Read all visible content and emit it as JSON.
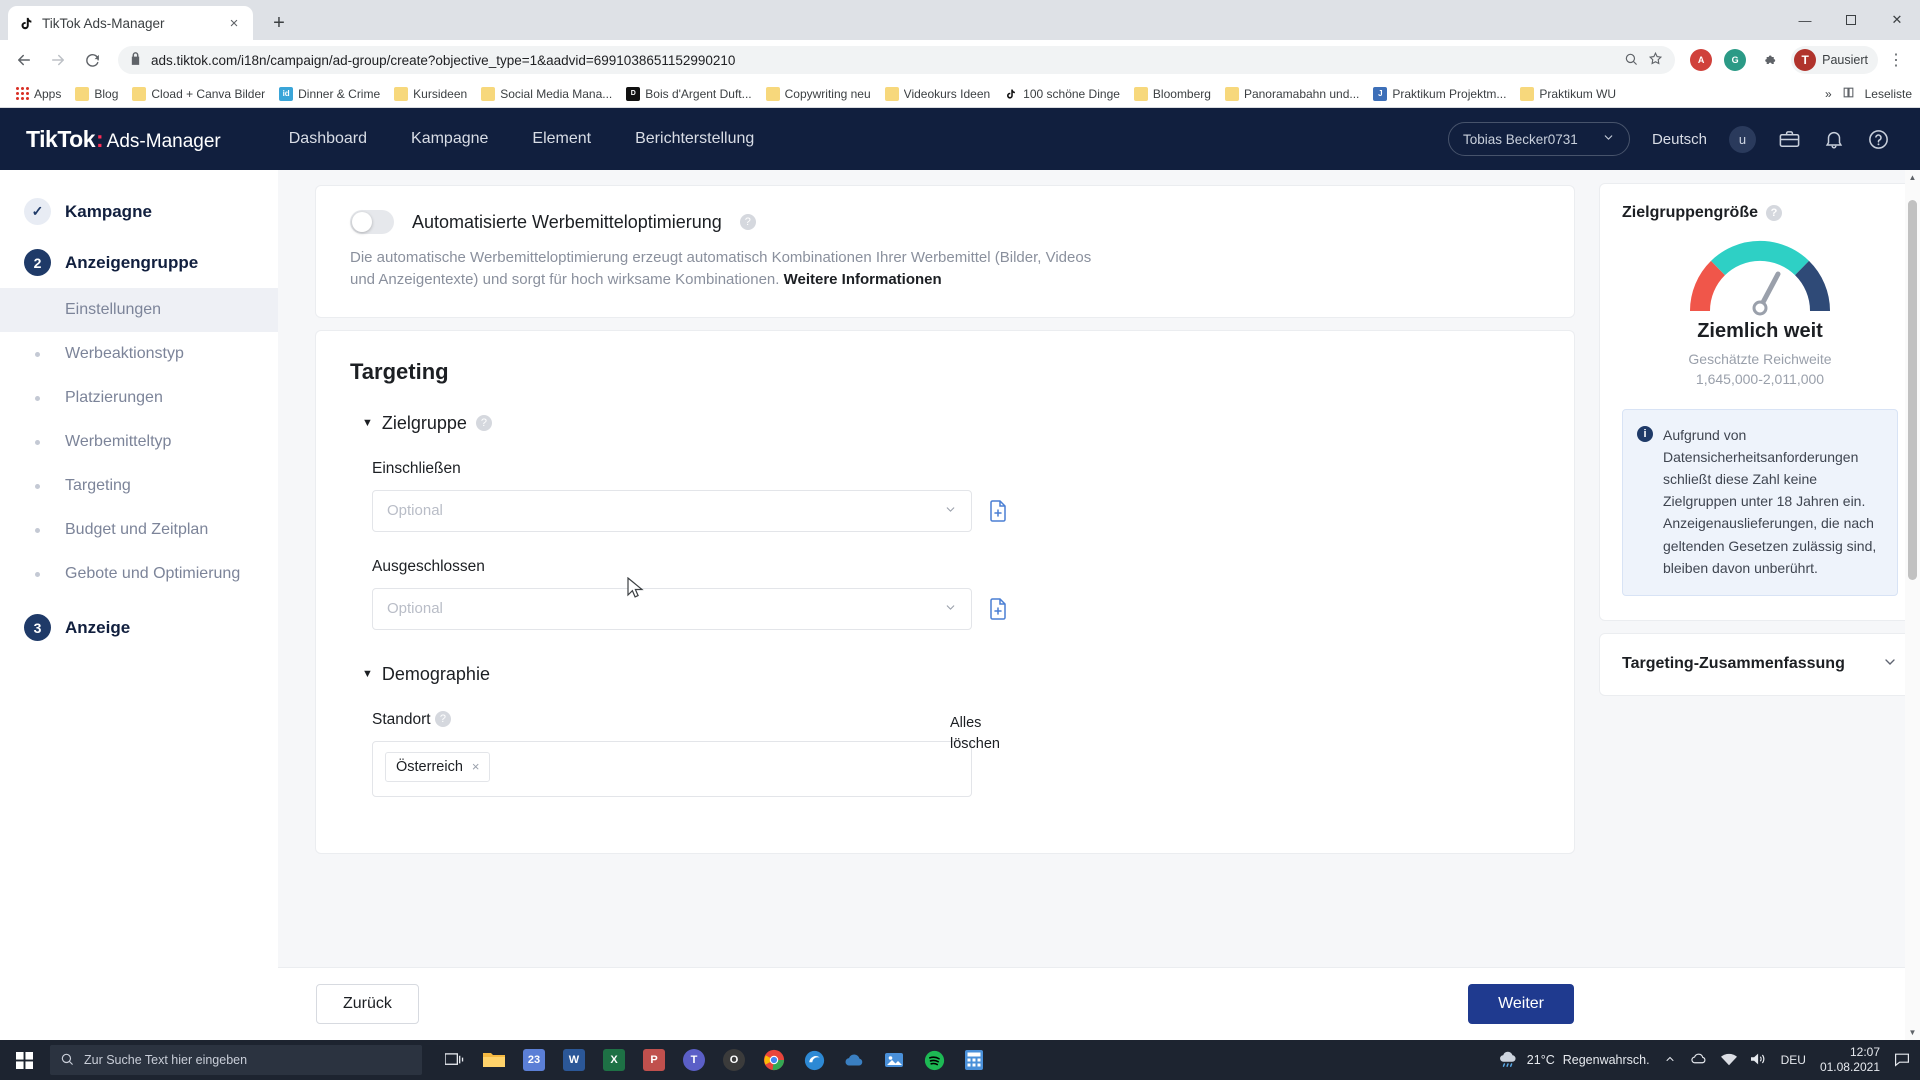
{
  "browser": {
    "tab": {
      "title": "TikTok Ads-Manager",
      "favicon": "tiktok-icon",
      "close": "×"
    },
    "newtab_label": "+",
    "window_controls": {
      "minimize": "—",
      "maximize": "☐",
      "close": "✕"
    },
    "nav": {
      "back": "←",
      "forward": "→",
      "reload": "↻"
    },
    "omnibox": {
      "url": "ads.tiktok.com/i18n/campaign/ad-group/create?objective_type=1&aadvid=6991038651152990210",
      "lock_icon": "lock-icon",
      "zoom_icon": "search-icon",
      "star_icon": "star-icon"
    },
    "extensions": [
      {
        "name": "adblock-extension",
        "label": "A",
        "color": "#d0413b"
      },
      {
        "name": "ghostery-extension",
        "label": "G",
        "color": "#2b9a86"
      },
      {
        "name": "puzzle-extension",
        "label": "❖",
        "color": "#5f6368"
      }
    ],
    "profile": {
      "initial": "T",
      "label": "Pausiert"
    },
    "menu_icon": "⋮",
    "bookmarks": [
      {
        "label": "Apps",
        "icon": "apps-grid-icon"
      },
      {
        "label": "Blog",
        "icon": "folder-icon"
      },
      {
        "label": "Cload + Canva Bilder",
        "icon": "folder-icon"
      },
      {
        "label": "Dinner & Crime",
        "icon": "imdb-icon"
      },
      {
        "label": "Kursideen",
        "icon": "folder-icon"
      },
      {
        "label": "Social Media Mana...",
        "icon": "folder-icon"
      },
      {
        "label": "Bois d'Argent Duft...",
        "icon": "dior-icon"
      },
      {
        "label": "Copywriting neu",
        "icon": "folder-icon"
      },
      {
        "label": "Videokurs Ideen",
        "icon": "folder-icon"
      },
      {
        "label": "100 schöne Dinge",
        "icon": "tiktok-icon"
      },
      {
        "label": "Bloomberg",
        "icon": "folder-icon"
      },
      {
        "label": "Panoramabahn und...",
        "icon": "folder-icon"
      },
      {
        "label": "Praktikum Projektm...",
        "icon": "jobs-icon"
      },
      {
        "label": "Praktikum WU",
        "icon": "folder-icon"
      }
    ],
    "bookmarks_overflow": "»",
    "reading_list": "Leseliste",
    "reading_list_icon": "reading-list-icon"
  },
  "topnav": {
    "brand": "TikTok",
    "brand_dot": ":",
    "brand_sub": "Ads-Manager",
    "items": [
      {
        "label": "Dashboard"
      },
      {
        "label": "Kampagne"
      },
      {
        "label": "Element"
      },
      {
        "label": "Berichterstellung"
      }
    ],
    "account": {
      "name": "Tobias Becker0731",
      "chevron": "∨"
    },
    "language": "Deutsch",
    "avatar_initial": "u",
    "icons": [
      {
        "name": "briefcase-icon"
      },
      {
        "name": "bell-icon"
      },
      {
        "name": "help-icon"
      }
    ]
  },
  "sidebar": {
    "steps": [
      {
        "label": "Kampagne",
        "badge": "✓",
        "state": "completed"
      },
      {
        "label": "Anzeigengruppe",
        "badge": "2",
        "state": "current"
      }
    ],
    "subitems": [
      {
        "label": "Einstellungen",
        "active": true
      },
      {
        "label": "Werbeaktionstyp",
        "active": false
      },
      {
        "label": "Platzierungen",
        "active": false
      },
      {
        "label": "Werbemitteltyp",
        "active": false
      },
      {
        "label": "Targeting",
        "active": false
      },
      {
        "label": "Budget und Zeitplan",
        "active": false
      },
      {
        "label": "Gebote und Optimierung",
        "active": false
      }
    ],
    "last_step": {
      "label": "Anzeige",
      "badge": "3"
    }
  },
  "main": {
    "automation_card": {
      "toggle_label": "Automatisierte Werbemitteloptimierung",
      "toggle_state": "off",
      "help_icon": "question-mark-icon",
      "description": "Die automatische Werbemitteloptimierung erzeugt automatisch Kombinationen Ihrer Werbemittel (Bilder, Videos und Anzeigentexte) und sorgt für hoch wirksame Kombinationen.",
      "link_label": "Weitere Informationen"
    },
    "targeting_card": {
      "title": "Targeting",
      "audience_section": {
        "label": "Zielgruppe",
        "caret": "▼",
        "help_icon": "question-mark-icon",
        "fields": [
          {
            "label": "Einschließen",
            "placeholder": "Optional",
            "chevron": "∨",
            "side_icon": "document-add-icon"
          },
          {
            "label": "Ausgeschlossen",
            "placeholder": "Optional",
            "chevron": "∨",
            "side_icon": "document-add-icon"
          }
        ]
      },
      "demographics_section": {
        "label": "Demographie",
        "caret": "▼",
        "location": {
          "label": "Standort",
          "help_icon": "question-mark-icon",
          "clear_all": "Alles löschen",
          "tags": [
            {
              "label": "Österreich",
              "remove": "×"
            }
          ]
        }
      }
    },
    "footer": {
      "back_label": "Zurück",
      "next_label": "Weiter"
    }
  },
  "rightpanel": {
    "audience_size": {
      "title": "Zielgruppengröße",
      "help_icon": "question-mark-icon",
      "gauge_icon": "gauge-icon",
      "result": "Ziemlich weit",
      "reach_label": "Geschätzte Reichweite",
      "reach_value": "1,645,000-2,011,000",
      "gauge_colors": {
        "low": "#f0564a",
        "mid": "#2ed0c5",
        "high": "#2f4a77",
        "needle": "#9aa0ab"
      }
    },
    "info": {
      "icon": "info-icon",
      "text": "Aufgrund von Datensicherheitsanforderungen schließt diese Zahl keine Zielgruppen unter 18 Jahren ein. Anzeigenauslieferungen, die nach geltenden Gesetzen zulässig sind, bleiben davon unberührt."
    },
    "summary": {
      "title": "Targeting-Zusammenfassung",
      "chevron": "∨"
    }
  },
  "taskbar": {
    "start_icon": "windows-icon",
    "search": {
      "placeholder": "Zur Suche Text hier eingeben",
      "icon": "search-icon"
    },
    "taskview_icon": "task-view-icon",
    "apps": [
      {
        "name": "file-explorer",
        "label": "▤",
        "color": "#f5b942"
      },
      {
        "name": "store-app",
        "label": "23",
        "color": "#5b7fd6"
      },
      {
        "name": "word-app",
        "label": "W",
        "color": "#2b5797"
      },
      {
        "name": "excel-app",
        "label": "X",
        "color": "#1e7145"
      },
      {
        "name": "powerpoint-app",
        "label": "P",
        "color": "#c0504d"
      },
      {
        "name": "teams-app",
        "label": "T",
        "color": "#5b5fc7"
      },
      {
        "name": "opera-app",
        "label": "O",
        "color": "#3b3b3b"
      },
      {
        "name": "chrome-app",
        "label": "",
        "color": "#e8453c"
      },
      {
        "name": "edge-app",
        "label": "",
        "color": "#2d89d4"
      },
      {
        "name": "onedrive-app",
        "label": "☁",
        "color": "#3a7fc1"
      },
      {
        "name": "photos-app",
        "label": "◰",
        "color": "#4a90d9"
      },
      {
        "name": "spotify-app",
        "label": "♫",
        "color": "#1db954"
      },
      {
        "name": "calculator-app",
        "label": "⊞",
        "color": "#4a90d9"
      }
    ],
    "tray": {
      "weather_temp": "21°C",
      "weather_desc": "Regenwahrsch.",
      "weather_icon": "rain-cloud-icon",
      "chevron_icon": "chevron-up-icon",
      "onedrive_icon": "cloud-icon",
      "network_icon": "network-icon",
      "volume_icon": "volume-icon",
      "language": "DEU",
      "time": "12:07",
      "date": "01.08.2021",
      "notification_icon": "notification-icon"
    }
  }
}
